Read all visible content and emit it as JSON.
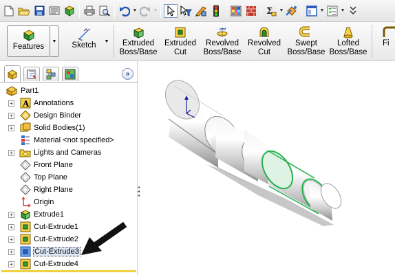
{
  "standard_toolbar": {
    "icons": [
      "new-document-icon",
      "open-folder-icon",
      "save-icon",
      "print-setup-icon",
      "rebuild-icon",
      "print-icon",
      "print-preview-icon",
      "undo-icon",
      "redo-icon",
      "select-arrow-icon",
      "filter-icon",
      "edit-appearance-icon",
      "traffic-light-icon",
      "grid-icon",
      "texture-icon",
      "sigma-icon",
      "options-icon",
      "view-window-icon",
      "checklist-icon",
      "collapse-icon"
    ]
  },
  "command_manager": {
    "features_tab": "Features",
    "sketch_tab": "Sketch",
    "buttons": [
      {
        "line1": "Extruded",
        "line2": "Boss/Base"
      },
      {
        "line1": "Extruded",
        "line2": "Cut"
      },
      {
        "line1": "Revolved",
        "line2": "Boss/Base"
      },
      {
        "line1": "Revolved",
        "line2": "Cut"
      },
      {
        "line1": "Swept",
        "line2": "Boss/Base"
      },
      {
        "line1": "Lofted",
        "line2": "Boss/Base"
      },
      {
        "line1": "Fi",
        "line2": ""
      }
    ]
  },
  "feature_manager": {
    "expand_symbol": "»",
    "root": "Part1",
    "items": [
      {
        "label": "Annotations",
        "expandable": true
      },
      {
        "label": "Design Binder",
        "expandable": true
      },
      {
        "label": "Solid Bodies(1)",
        "expandable": true
      },
      {
        "label": "Material <not specified>",
        "expandable": false
      },
      {
        "label": "Lights and Cameras",
        "expandable": true
      },
      {
        "label": "Front Plane",
        "expandable": false
      },
      {
        "label": "Top Plane",
        "expandable": false
      },
      {
        "label": "Right Plane",
        "expandable": false
      },
      {
        "label": "Origin",
        "expandable": false
      },
      {
        "label": "Extrude1",
        "expandable": true
      },
      {
        "label": "Cut-Extrude1",
        "expandable": true
      },
      {
        "label": "Cut-Extrude2",
        "expandable": true
      },
      {
        "label": "Cut-Extrude3",
        "expandable": true,
        "selected": true
      },
      {
        "label": "Cut-Extrude4",
        "expandable": true
      }
    ]
  },
  "colors": {
    "selection_green": "#22b14c",
    "highlight": "#dde7f6",
    "rollback_bar": "#f0d040"
  }
}
